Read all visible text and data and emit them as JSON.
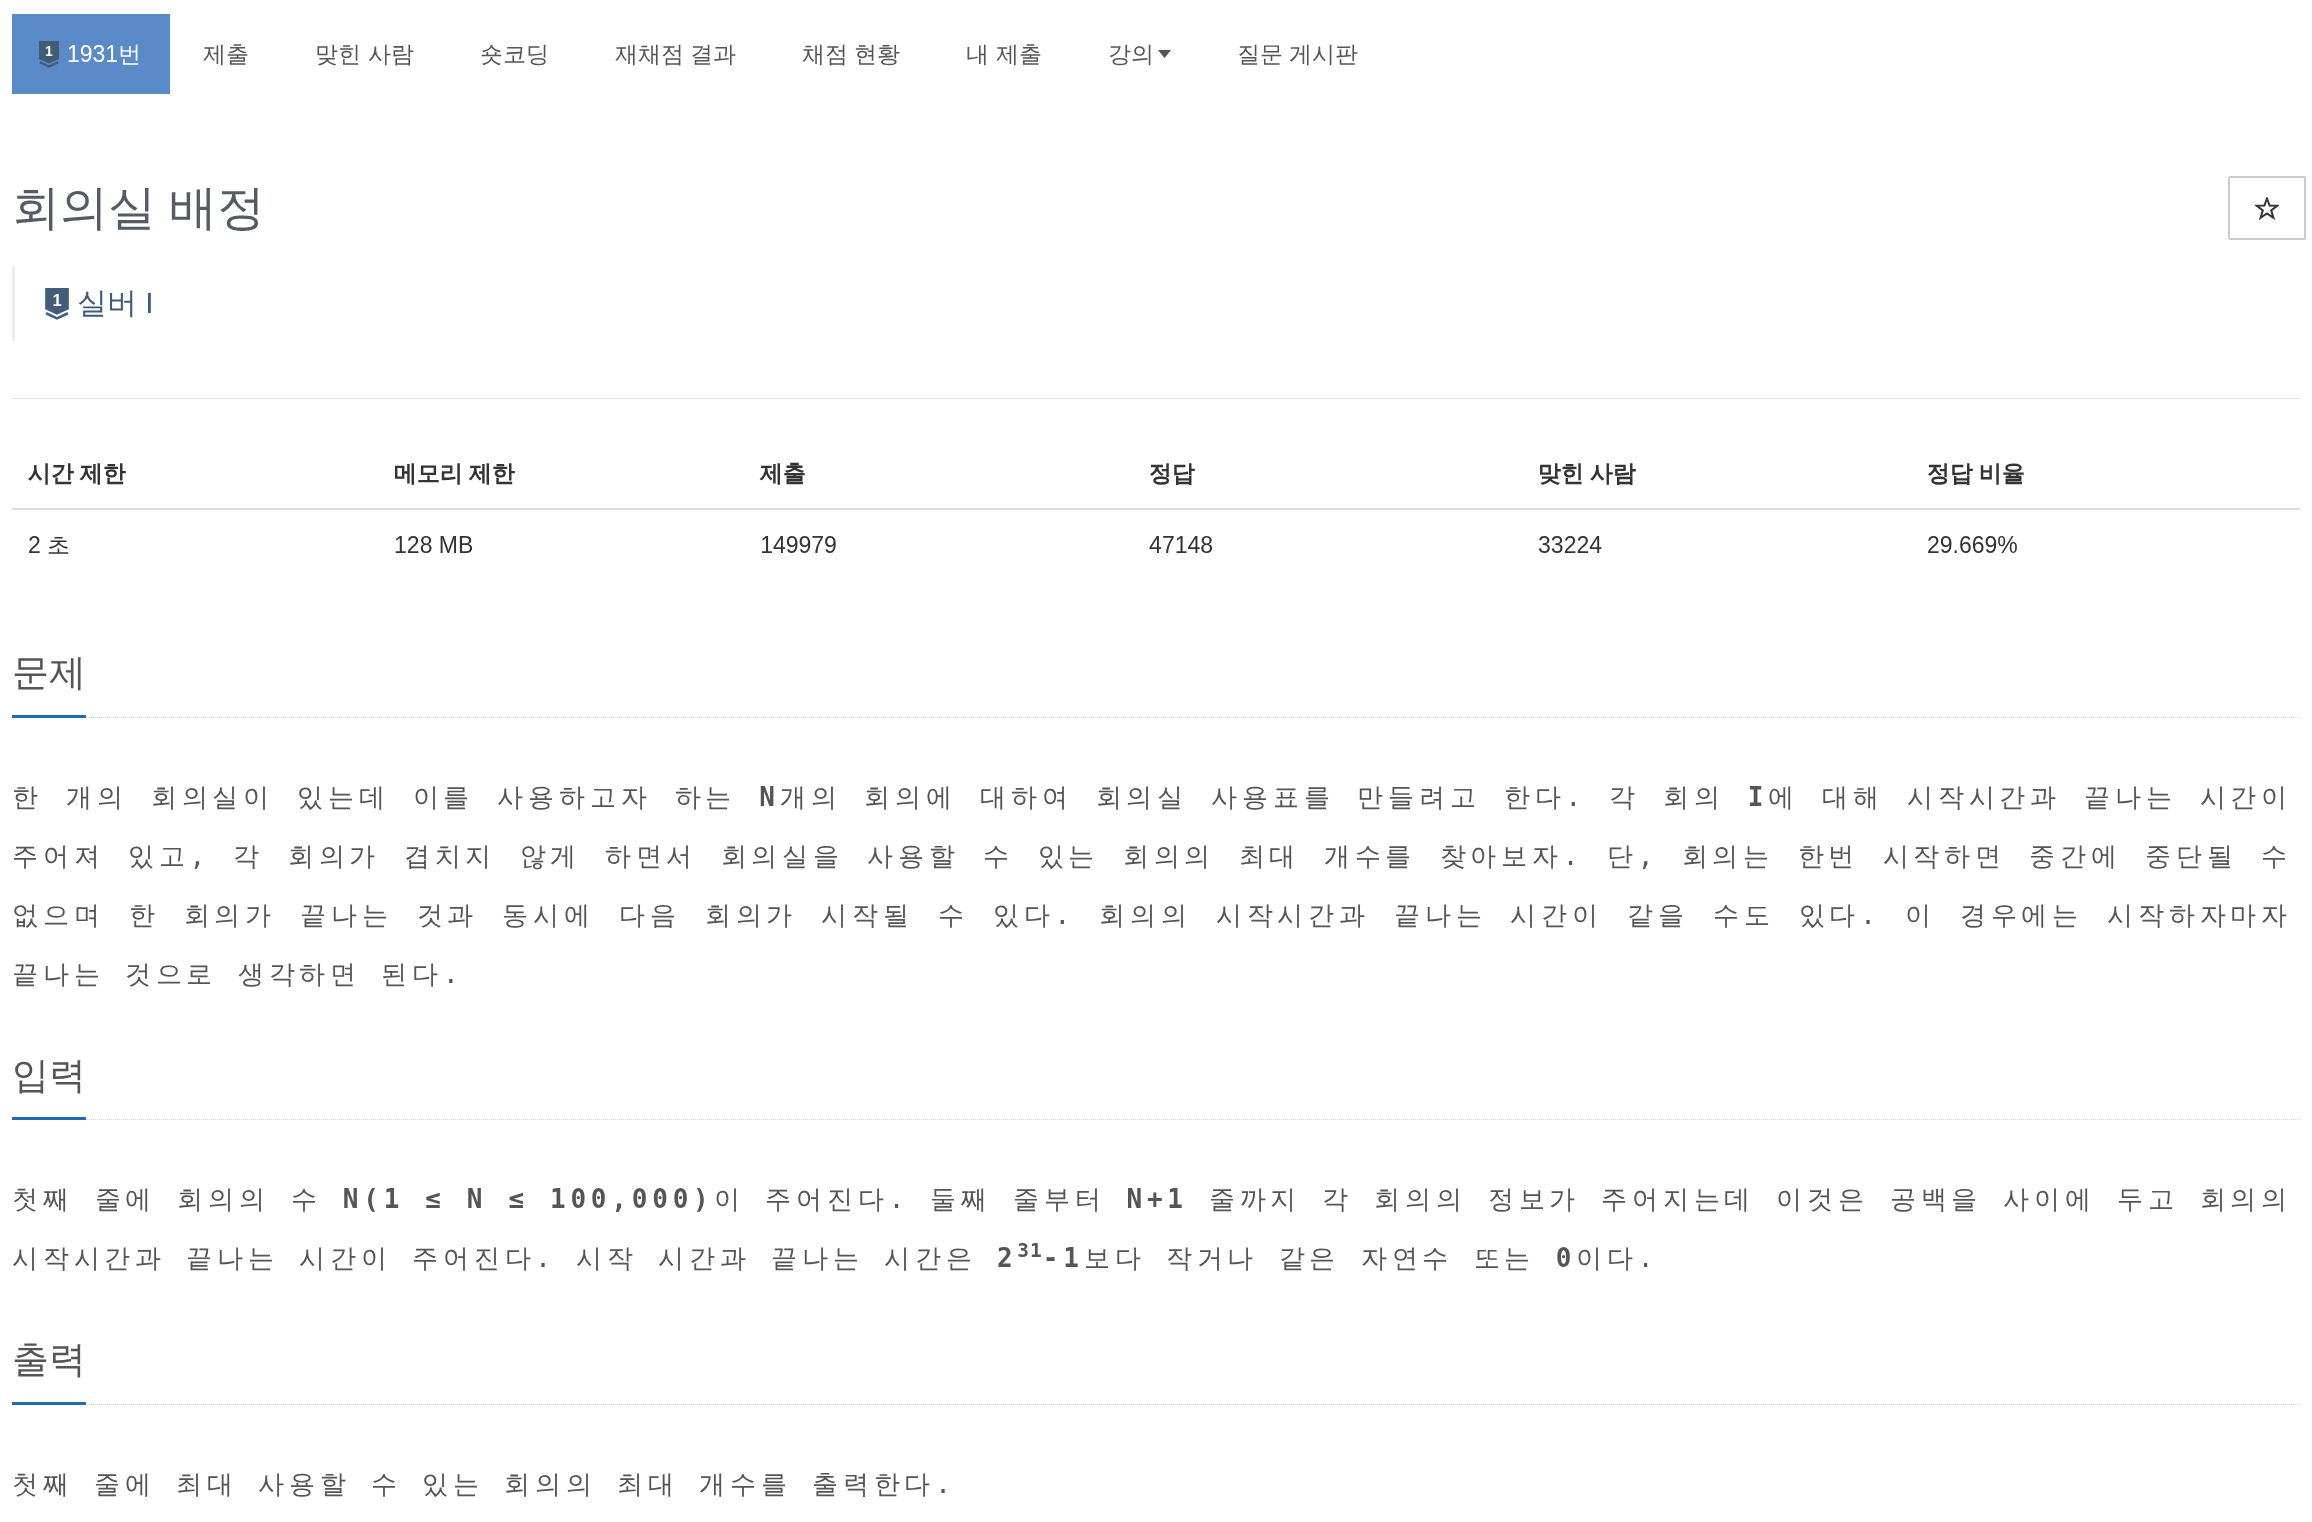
{
  "nav": {
    "tabs": [
      {
        "label": "1931번",
        "selected": true,
        "kind": "problem",
        "badge": "1"
      },
      {
        "label": "제출",
        "selected": false,
        "kind": "link"
      },
      {
        "label": "맞힌 사람",
        "selected": false,
        "kind": "link"
      },
      {
        "label": "숏코딩",
        "selected": false,
        "kind": "link"
      },
      {
        "label": "재채점 결과",
        "selected": false,
        "kind": "link"
      },
      {
        "label": "채점 현황",
        "selected": false,
        "kind": "link"
      },
      {
        "label": "내 제출",
        "selected": false,
        "kind": "link"
      },
      {
        "label": "강의",
        "selected": false,
        "kind": "dropdown"
      },
      {
        "label": "질문 게시판",
        "selected": false,
        "kind": "link"
      }
    ]
  },
  "problem": {
    "title": "회의실 배정",
    "tier": {
      "badge": "1",
      "label": "실버 I"
    }
  },
  "table": {
    "columns": [
      "시간 제한",
      "메모리 제한",
      "제출",
      "정답",
      "맞힌 사람",
      "정답 비율"
    ],
    "rows": [
      [
        "2 초",
        "128 MB",
        "149979",
        "47148",
        "33224",
        "29.669%"
      ]
    ]
  },
  "sections": [
    {
      "heading": "문제",
      "paragraphs": [
        "한 개의 회의실이 있는데 이를 사용하고자 하는 **N**개의 회의에 대하여 회의실 사용표를 만들려고 한다. 각 회의 **I**에 대해 시작시간과 끝나는 시간이 주어져 있고, 각 회의가 겹치지 않게 하면서 회의실을 사용할 수 있는 회의의 최대 개수를 찾아보자. 단, 회의는 한번 시작하면 중간에 중단될 수 없으며 한 회의가 끝나는 것과 동시에 다음 회의가 시작될 수 있다. 회의의 시작시간과 끝나는 시간이 같을 수도 있다. 이 경우에는 시작하자마자 끝나는 것으로 생각하면 된다."
      ]
    },
    {
      "heading": "입력",
      "paragraphs": [
        "첫째 줄에 회의의 수 **N(1 ≤ N ≤ 100,000)**이 주어진다. 둘째 줄부터 **N+1** 줄까지 각 회의의 정보가 주어지는데 이것은 공백을 사이에 두고 회의의 시작시간과 끝나는 시간이 주어진다. 시작 시간과 끝나는 시간은 **2**$^{31}$**-1**보다 작거나 같은 자연수 또는 **0**이다."
      ]
    },
    {
      "heading": "출력",
      "paragraphs": [
        "첫째 줄에 최대 사용할 수 있는 회의의 최대 개수를 출력한다."
      ]
    }
  ]
}
